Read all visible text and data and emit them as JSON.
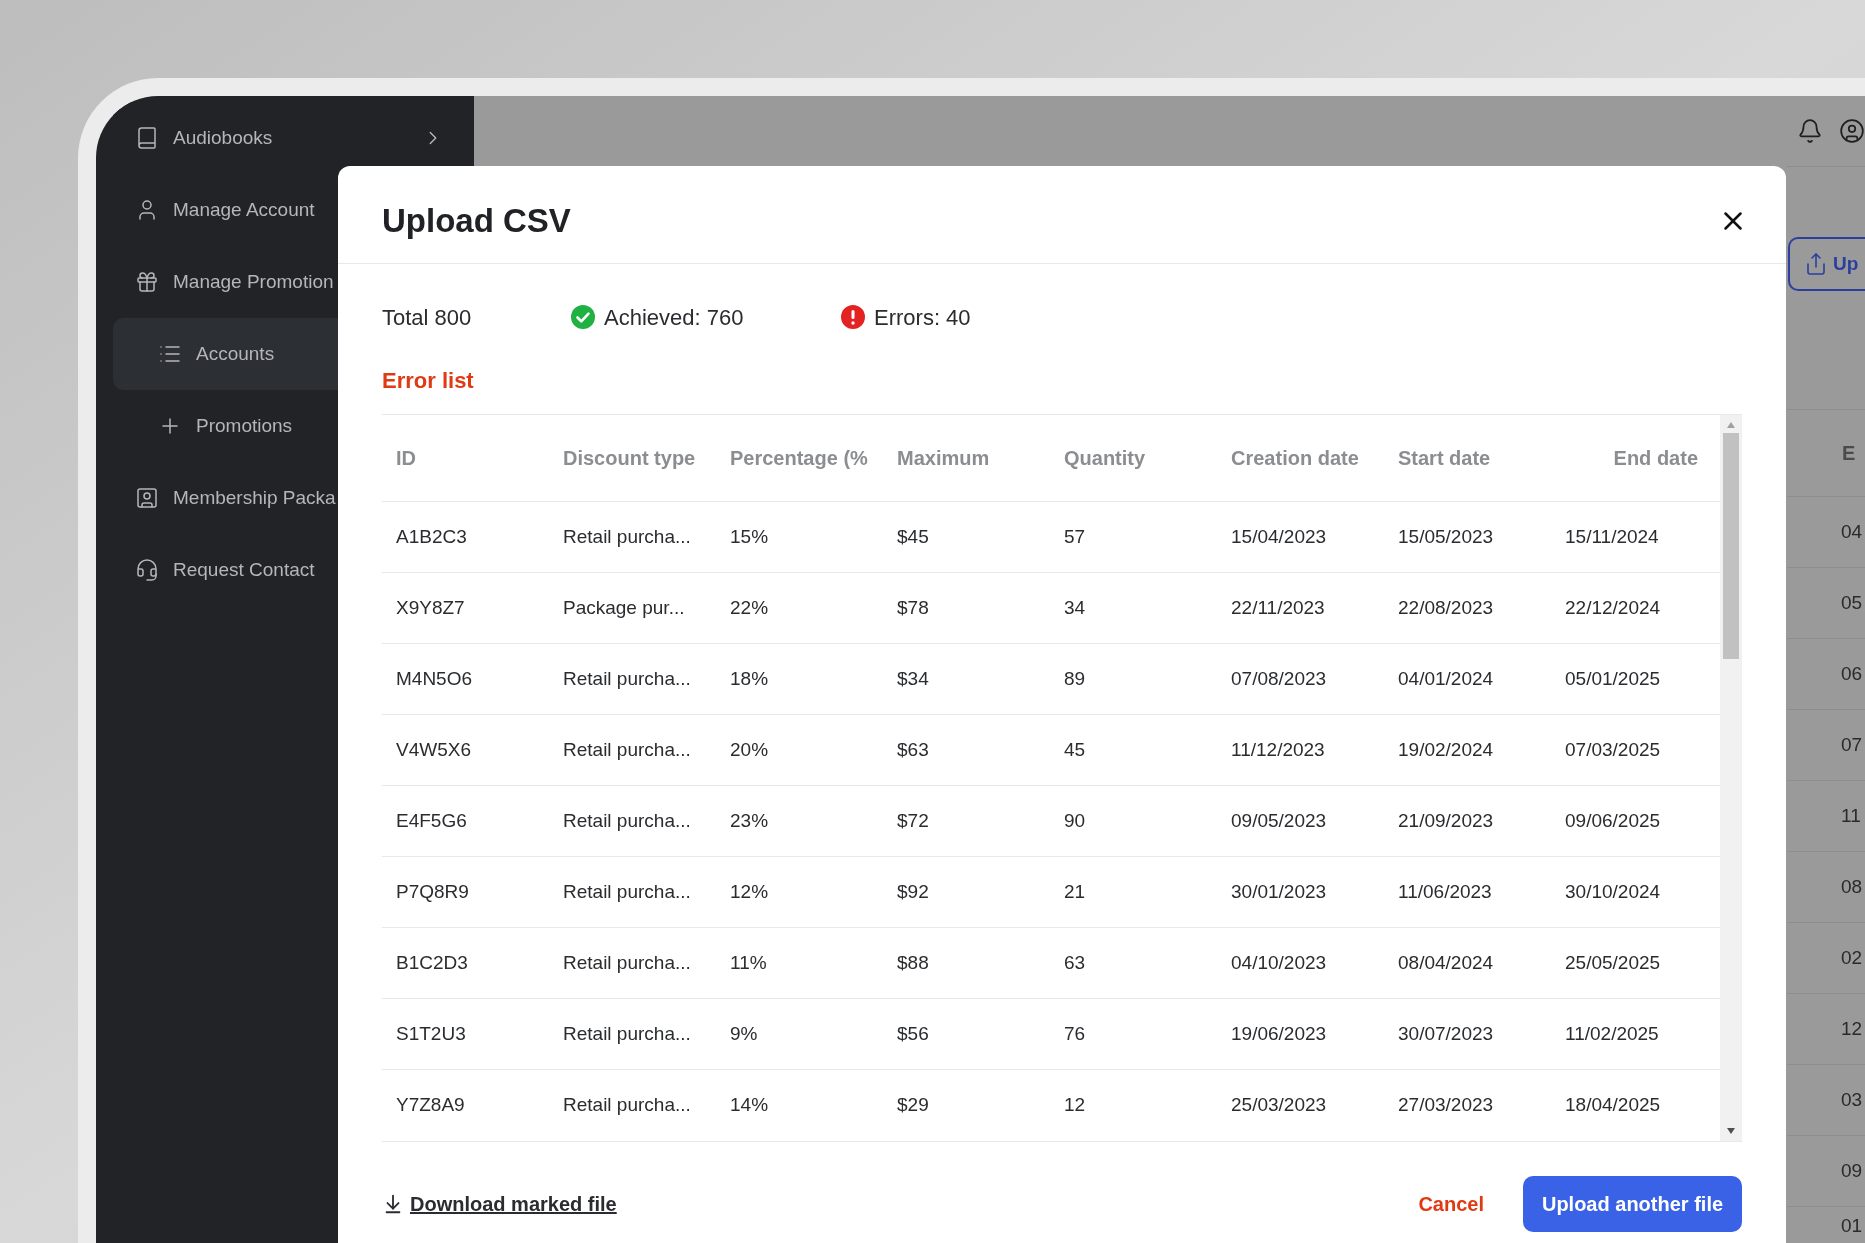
{
  "sidebar": {
    "items": [
      {
        "label": "Audiobooks",
        "kind": "expandable",
        "selected": false
      },
      {
        "label": "Manage Account",
        "kind": "link",
        "selected": false
      },
      {
        "label": "Manage Promotion",
        "kind": "link",
        "selected": false,
        "children": [
          {
            "label": "Accounts",
            "selected": true
          },
          {
            "label": "Promotions",
            "selected": false
          }
        ]
      },
      {
        "label": "Membership Packa",
        "kind": "link",
        "selected": false
      },
      {
        "label": "Request Contact",
        "kind": "link",
        "selected": false
      }
    ]
  },
  "background_page": {
    "upload_button": "Up",
    "table": {
      "column_header": "E",
      "cells": [
        "04",
        "05",
        "06",
        "07",
        "11",
        "08",
        "02",
        "12",
        "03",
        "09",
        "01"
      ]
    }
  },
  "dialog": {
    "title": "Upload CSV",
    "stats": {
      "total": "Total 800",
      "achieved": "Achieved: 760",
      "errors": "Errors: 40"
    },
    "error_list_title": "Error list",
    "table": {
      "columns": [
        "ID",
        "Discount type",
        "Percentage (%",
        "Maximum",
        "Quantity",
        "Creation date",
        "Start date",
        "End date"
      ],
      "rows": [
        [
          "A1B2C3",
          "Retail purcha...",
          "15%",
          "$45",
          "57",
          "15/04/2023",
          "15/05/2023",
          "15/11/2024"
        ],
        [
          "X9Y8Z7",
          "Package pur...",
          "22%",
          "$78",
          "34",
          "22/11/2023",
          "22/08/2023",
          "22/12/2024"
        ],
        [
          "M4N5O6",
          "Retail purcha...",
          "18%",
          "$34",
          "89",
          "07/08/2023",
          "04/01/2024",
          "05/01/2025"
        ],
        [
          "V4W5X6",
          "Retail purcha...",
          "20%",
          "$63",
          "45",
          "11/12/2023",
          "19/02/2024",
          "07/03/2025"
        ],
        [
          "E4F5G6",
          "Retail purcha...",
          "23%",
          "$72",
          "90",
          "09/05/2023",
          "21/09/2023",
          "09/06/2025"
        ],
        [
          "P7Q8R9",
          "Retail purcha...",
          "12%",
          "$92",
          "21",
          "30/01/2023",
          "11/06/2023",
          "30/10/2024"
        ],
        [
          "B1C2D3",
          "Retail purcha...",
          "11%",
          "$88",
          "63",
          "04/10/2023",
          "08/04/2024",
          "25/05/2025"
        ],
        [
          "S1T2U3",
          "Retail purcha...",
          "9%",
          "$56",
          "76",
          "19/06/2023",
          "30/07/2023",
          "11/02/2025"
        ],
        [
          "Y7Z8A9",
          "Retail purcha...",
          "14%",
          "$29",
          "12",
          "25/03/2023",
          "27/03/2023",
          "18/04/2025"
        ]
      ]
    },
    "footer": {
      "download_link": "Download marked file",
      "cancel": "Cancel",
      "upload_button": "Upload another file"
    }
  }
}
